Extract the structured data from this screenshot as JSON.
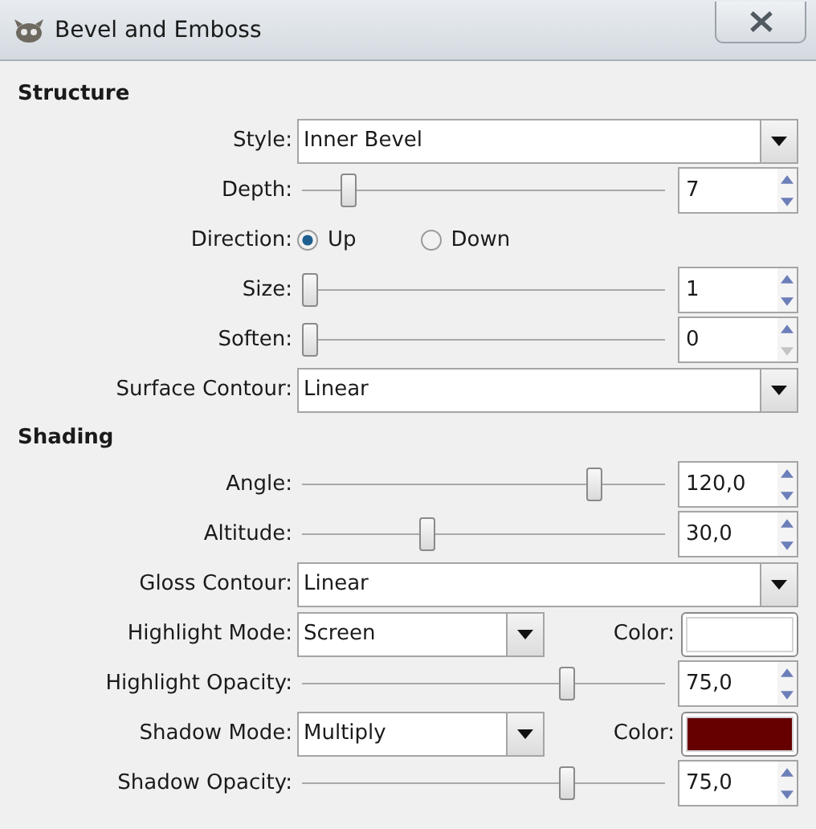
{
  "window": {
    "title": "Bevel and Emboss"
  },
  "sections": [
    {
      "heading": "Structure",
      "rows": [
        {
          "kind": "dropdown",
          "label": "Style:",
          "value": "Inner Bevel"
        },
        {
          "kind": "slider",
          "label": "Depth:",
          "level": 0.11,
          "value": "7",
          "down_disabled": false
        },
        {
          "kind": "radio",
          "label": "Direction:",
          "options": [
            {
              "label": "Up",
              "selected": true
            },
            {
              "label": "Down",
              "selected": false
            }
          ]
        },
        {
          "kind": "slider",
          "label": "Size:",
          "level": 0,
          "value": "1",
          "down_disabled": false
        },
        {
          "kind": "slider",
          "label": "Soften:",
          "level": 0,
          "value": "0",
          "down_disabled": true
        },
        {
          "kind": "dropdown",
          "label": "Surface Contour:",
          "value": "Linear"
        }
      ]
    },
    {
      "heading": "Shading",
      "rows": [
        {
          "kind": "slider",
          "label": "Angle:",
          "level": 0.82,
          "value": "120,0",
          "down_disabled": false
        },
        {
          "kind": "slider",
          "label": "Altitude:",
          "level": 0.34,
          "value": "30,0",
          "down_disabled": false
        },
        {
          "kind": "dropdown",
          "label": "Gloss Contour:",
          "value": "Linear"
        },
        {
          "kind": "mode",
          "label": "Highlight Mode:",
          "value": "Screen",
          "color_label": "Color:",
          "color": "#ffffff"
        },
        {
          "kind": "slider",
          "label": "Highlight Opacity:",
          "level": 0.74,
          "value": "75,0",
          "down_disabled": false
        },
        {
          "kind": "mode",
          "label": "Shadow Mode:",
          "value": "Multiply",
          "color_label": "Color:",
          "color": "#660000"
        },
        {
          "kind": "slider",
          "label": "Shadow Opacity:",
          "level": 0.74,
          "value": "75,0",
          "down_disabled": false
        }
      ]
    }
  ]
}
